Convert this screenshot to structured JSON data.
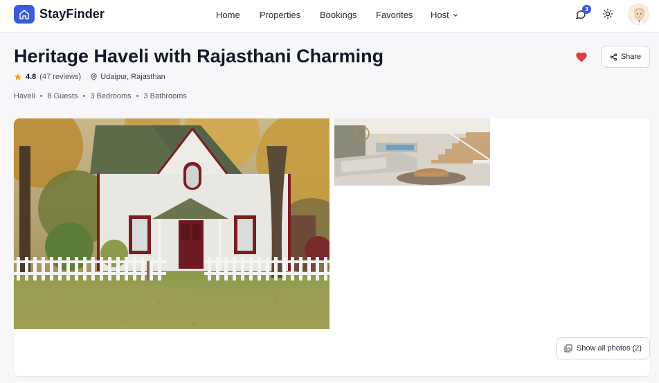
{
  "brand": {
    "name": "StayFinder",
    "icon": "home-icon",
    "color": "#3b5bdb"
  },
  "nav": {
    "items": [
      {
        "label": "Home"
      },
      {
        "label": "Properties"
      },
      {
        "label": "Bookings"
      },
      {
        "label": "Favorites"
      },
      {
        "label": "Host"
      }
    ]
  },
  "header_actions": {
    "messages_icon": "chat-icon",
    "message_count": "3",
    "theme_icon": "sun-icon",
    "avatar_icon": "user-avatar"
  },
  "listing": {
    "title": "Heritage Haveli with Rajasthani Charming",
    "rating": "4.8",
    "reviews": "(47 reviews)",
    "location": "Udaipur, Rajasthan",
    "details": [
      "Haveli",
      "8 Guests",
      "3 Bedrooms",
      "3 Bathrooms"
    ],
    "favorited": true,
    "heart_color": "#e03e3e"
  },
  "actions": {
    "share_label": "Share",
    "show_all_label": "Show all photos (2)"
  },
  "gallery": {
    "photo_count": 2,
    "main_photo": "white-house-autumn-photo",
    "side_photo": "modern-living-room-photo"
  }
}
